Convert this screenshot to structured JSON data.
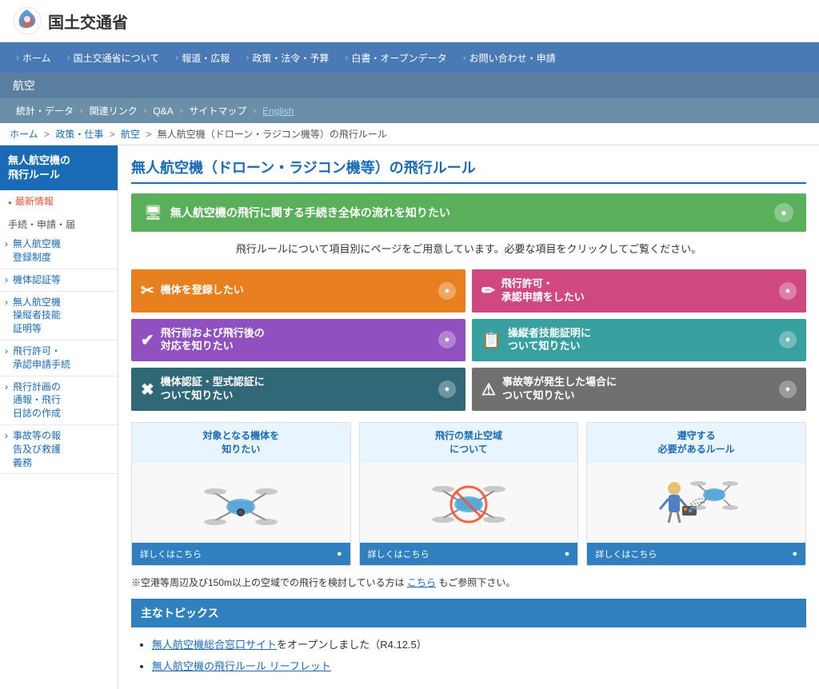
{
  "header": {
    "logo_text": "国土交通省",
    "logo_alt": "MLIT Logo"
  },
  "nav": {
    "items": [
      {
        "label": "ホーム",
        "arrow": "›"
      },
      {
        "label": "国土交通省について",
        "arrow": "›"
      },
      {
        "label": "報道・広報",
        "arrow": "›"
      },
      {
        "label": "政策・法令・予算",
        "arrow": "›"
      },
      {
        "label": "白書・オープンデータ",
        "arrow": "›"
      },
      {
        "label": "お問い合わせ・申請",
        "arrow": "›"
      }
    ]
  },
  "section_bar": {
    "label": "航空"
  },
  "sub_nav": {
    "items": [
      {
        "label": "統計・データ",
        "type": "normal"
      },
      {
        "label": "関連リンク",
        "type": "normal"
      },
      {
        "label": "Q&A",
        "type": "normal"
      },
      {
        "label": "サイトマップ",
        "type": "normal"
      },
      {
        "label": "English",
        "type": "english"
      }
    ]
  },
  "breadcrumb": {
    "items": [
      {
        "label": "ホーム",
        "link": true
      },
      {
        "label": "政策・仕事",
        "link": true
      },
      {
        "label": "航空",
        "link": true
      },
      {
        "label": "無人航空機（ドローン・ラジコン機等）の飛行ルール",
        "link": false
      }
    ]
  },
  "sidebar": {
    "header": "無人航空機の\n飛行ルール",
    "latest_label": "最新情報",
    "section_label": "手続・申請・届",
    "links": [
      "無人航空機\n登録制度",
      "機体認証等",
      "無人航空機\n操縦者技能\n証明等",
      "飛行許可・\n承認申請手続",
      "飛行計画の\n通報・飛行\n日誌の作成",
      "事故等の報\n告及び救護\n義務"
    ]
  },
  "content": {
    "page_title": "無人航空機（ドローン・ラジコン機等）の飛行ルール",
    "green_banner": {
      "text": "無人航空機の飛行に関する手続き全体の流れを知りたい",
      "icon": "🖥"
    },
    "intro_text": "飛行ルールについて項目別にページをご用意しています。必要な項目をクリックしてご覧ください。",
    "action_buttons": [
      {
        "text": "機体を登録したい",
        "icon": "✂",
        "color": "orange"
      },
      {
        "text": "飛行許可・\n承認申請をしたい",
        "icon": "✏",
        "color": "pink"
      },
      {
        "text": "飛行前および飛行後の\n対応を知りたい",
        "icon": "✔",
        "color": "purple"
      },
      {
        "text": "操縦者技能証明に\nついて知りたい",
        "icon": "📋",
        "color": "teal"
      },
      {
        "text": "機体認証・型式認証に\nついて知りたい",
        "icon": "✖",
        "color": "dark-teal"
      },
      {
        "text": "事故等が発生した場合に\nついて知りたい",
        "icon": "⚠",
        "color": "dark"
      }
    ],
    "image_cards": [
      {
        "title": "対象となる機体を\n知りたい",
        "footer_text": "詳しくはこちら",
        "img_type": "drone_normal"
      },
      {
        "title": "飛行の禁止空域\nについて",
        "footer_text": "詳しくはこちら",
        "img_type": "drone_prohibited"
      },
      {
        "title": "遵守する\n必要があるルール",
        "footer_text": "詳しくはこちら",
        "img_type": "drone_person"
      }
    ],
    "notice_text": "※空港等周辺及び150m以上の空域での飛行を検討している方は",
    "notice_link": "こちら",
    "notice_text2": "もご参照下さい。",
    "topics_header": "主なトピックス",
    "topics_items": [
      {
        "text": "無人航空機総合窓口サイト",
        "link": true,
        "suffix": "をオープンしました（R4.12.5）"
      },
      {
        "text": "無人航空機の飛行ルール リーフレット",
        "link": true,
        "suffix": ""
      }
    ]
  },
  "colors": {
    "nav_bg": "#4a7ab5",
    "section_bg": "#5a7fa0",
    "sub_nav_bg": "#6b8fa8",
    "sidebar_header_bg": "#1a6bb5",
    "green_banner_bg": "#5ab05a",
    "orange_btn": "#e88020",
    "pink_btn": "#d04880",
    "purple_btn": "#9050c0",
    "teal_btn": "#38a0a0",
    "dark_teal_btn": "#306878",
    "dark_btn": "#707070",
    "topics_header_bg": "#3080c0",
    "card_footer_bg": "#3080c0",
    "card_title_bg": "#e8f4ff"
  }
}
